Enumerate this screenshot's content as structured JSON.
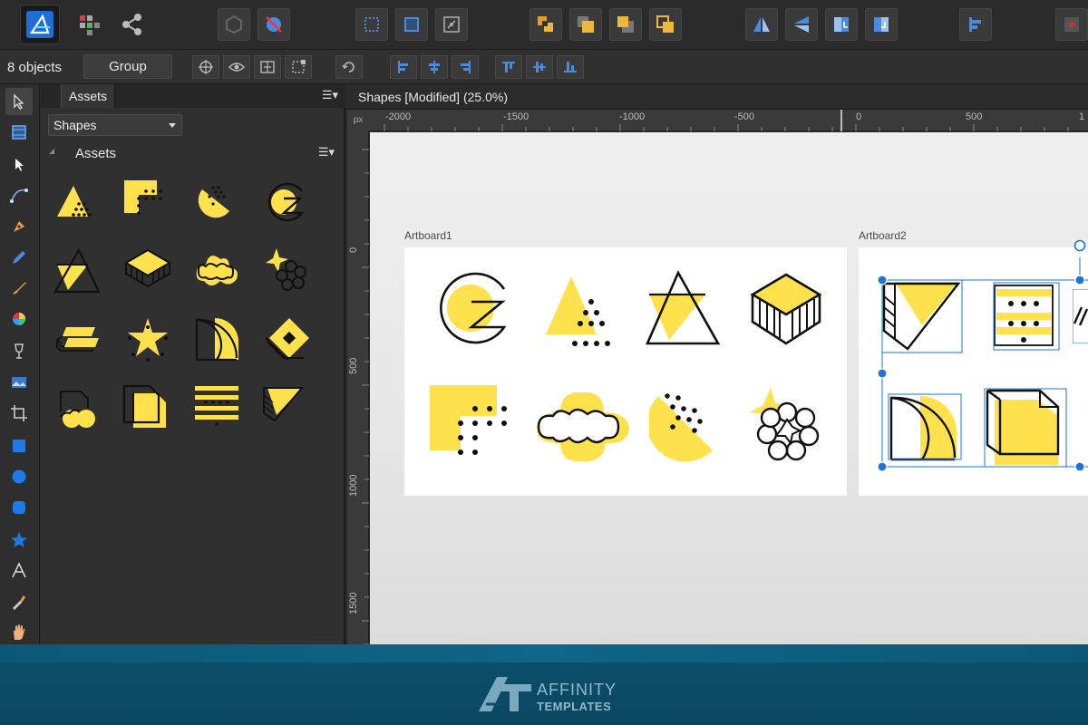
{
  "context_bar": {
    "object_count": "8 objects",
    "group_button": "Group"
  },
  "assets_panel": {
    "tab_label": "Assets",
    "panel_menu_icon": "hamburger-menu-icon",
    "category_select": "Shapes",
    "category_header": "Assets",
    "items": [
      "triangle-dots",
      "square-dots",
      "half-circle-dots",
      "letter-c-z",
      "triangle-in-triangle",
      "isometric-cube",
      "cloud",
      "star-flower",
      "stacked-bars",
      "star-dots",
      "quarter-circle",
      "diamond-square",
      "paper-cloud",
      "folded-square",
      "stripes-dots",
      "slanted-wedge"
    ]
  },
  "document": {
    "title": "Shapes [Modified] (25.0%)",
    "ruler_unit": "px",
    "ruler_h_labels": [
      "-2000",
      "-1500",
      "-1000",
      "-500",
      "0",
      "500",
      "1"
    ],
    "ruler_v_labels": [
      "0",
      "500",
      "1000",
      "1500"
    ],
    "artboards": [
      {
        "label": "Artboard1"
      },
      {
        "label": "Artboard2"
      }
    ]
  },
  "colors": {
    "accent_yellow": "#ffe14d",
    "selection_blue": "#1e74d6",
    "ui_dark": "#2b2b2b",
    "footer_teal": "#0b4f6b",
    "brand_text": "#8fb9c9"
  },
  "brand": {
    "line1": "AFFINITY",
    "line2": "TEMPLATES"
  }
}
